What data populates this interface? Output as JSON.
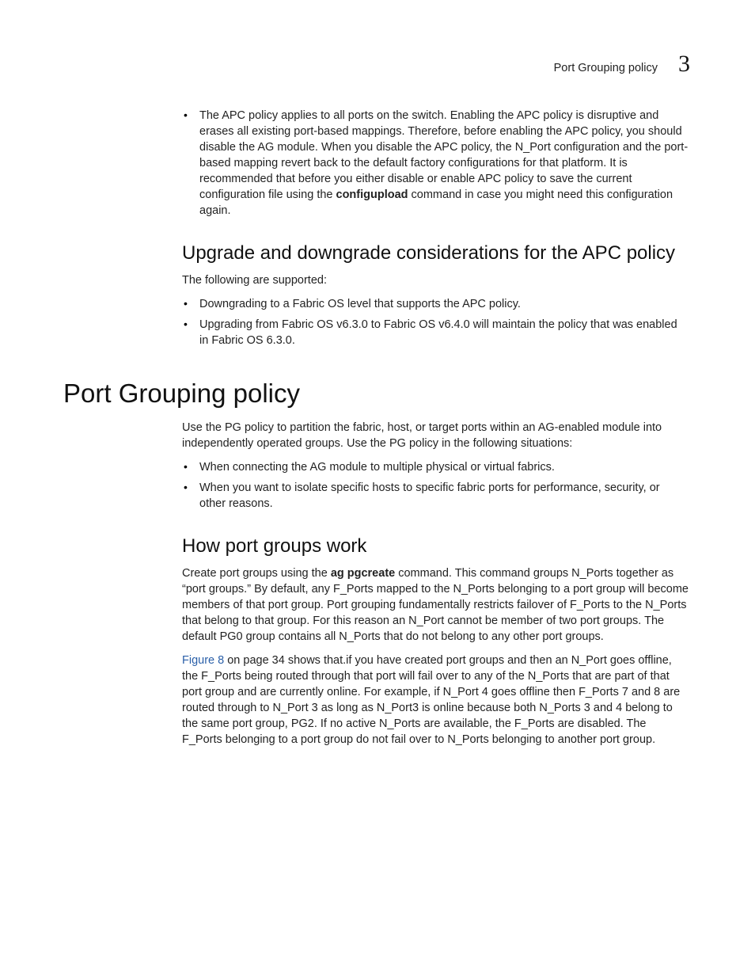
{
  "header": {
    "title": "Port Grouping policy",
    "chapter": "3"
  },
  "apc_bullet": {
    "prefix": "The APC policy applies to all ports on the switch. Enabling the APC policy is disruptive and erases all existing port-based mappings. Therefore, before enabling the APC policy, you should disable the AG module. When you disable the APC policy, the N_Port configuration and the port-based mapping revert back to the default factory configurations for that platform. It is recommended that before you either disable or enable APC policy to save the current configuration file using the ",
    "bold": "configupload",
    "suffix": " command in case you might need this configuration again."
  },
  "upgrade": {
    "heading": "Upgrade and downgrade considerations for the APC policy",
    "intro": "The following are supported:",
    "items": [
      "Downgrading to a Fabric OS level that supports the APC policy.",
      "Upgrading from Fabric OS v6.3.0 to Fabric OS v6.4.0 will maintain the policy that was enabled in Fabric OS 6.3.0."
    ]
  },
  "pg": {
    "h1": "Port Grouping policy",
    "intro": "Use the PG policy to partition the fabric, host, or target ports within an AG-enabled module into independently operated groups. Use the PG policy in the following situations:",
    "items": [
      "When connecting the AG module to multiple physical or virtual fabrics.",
      "When you want to isolate specific hosts to specific fabric ports for performance, security, or other reasons."
    ]
  },
  "how": {
    "heading": "How port groups work",
    "para1_prefix": "Create port groups using the ",
    "para1_bold1": "ag",
    "para1_mid": "     ",
    "para1_bold2": "pgcreate",
    "para1_suffix": " command. This command groups N_Ports together as “port groups.” By default, any F_Ports mapped to the N_Ports belonging to a port group will become members of that port group. Port grouping fundamentally restricts failover of F_Ports to the N_Ports that belong to that group. For this reason an N_Port cannot be member of two port groups. The default PG0 group contains all N_Ports that do not belong to any other port groups.",
    "para2_link": "Figure 8",
    "para2_rest": " on page 34 shows that.if you have created port groups and then an N_Port goes offline, the F_Ports being routed through that port will fail over to any of the N_Ports that are part of that port group and are currently online. For example, if N_Port 4 goes offline then F_Ports 7 and 8 are routed through to N_Port 3 as long as N_Port3 is online because both N_Ports 3 and 4 belong to the same port group, PG2. If no active N_Ports are available, the F_Ports are disabled. The F_Ports belonging to a port group do not fail over to N_Ports belonging to another port group."
  }
}
